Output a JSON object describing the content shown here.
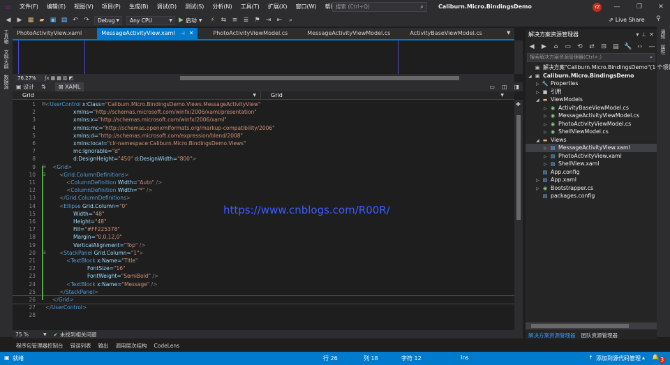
{
  "menubar": {
    "items": [
      "文件(F)",
      "编辑(E)",
      "视图(V)",
      "项目(P)",
      "生成(B)",
      "调试(D)",
      "测试(S)",
      "分析(N)",
      "工具(T)",
      "扩展(X)",
      "窗口(W)",
      "帮助(H)"
    ],
    "search_placeholder": "搜索 (Ctrl+Q)",
    "solution_title": "Caliburn.Micro.BindingsDemo",
    "avatar_initials": "YZ"
  },
  "toolbar": {
    "config": "Debug",
    "platform": "Any CPU",
    "start_label": "启动",
    "live_share": "Live Share"
  },
  "left_strip": [
    "工具箱",
    "文档大纲",
    "数据源"
  ],
  "right_strip": [
    "通知",
    "属性"
  ],
  "tabs": [
    {
      "label": "PhotoActivityView.xaml",
      "active": false
    },
    {
      "label": "MessageActivityView.xaml",
      "active": true
    },
    {
      "label": "PhotoActivityViewModel.cs",
      "active": false
    },
    {
      "label": "MessageActivityViewModel.cs",
      "active": false
    },
    {
      "label": "ActivityBaseViewModel.cs",
      "active": false
    }
  ],
  "designer": {
    "zoom": "76.27%"
  },
  "split": {
    "design": "设计",
    "xaml": "XAML"
  },
  "navbar": {
    "left": "Grid",
    "right": "Grid"
  },
  "code": [
    {
      "n": "1",
      "fold": "⊟",
      "indent": 0,
      "parts": [
        [
          "br",
          "<"
        ],
        [
          "tag",
          "UserControl"
        ],
        [
          "attr",
          " x:Class="
        ],
        [
          "val",
          "\"Caliburn.Micro.BindingsDemo.Views.MessageActivityView\""
        ]
      ]
    },
    {
      "n": "2",
      "fold": "",
      "indent": 8,
      "parts": [
        [
          "attr",
          "xmlns="
        ],
        [
          "val",
          "\"http://schemas.microsoft.com/winfx/2006/xaml/presentation\""
        ]
      ]
    },
    {
      "n": "3",
      "fold": "",
      "indent": 8,
      "parts": [
        [
          "attr",
          "xmlns:x="
        ],
        [
          "val",
          "\"http://schemas.microsoft.com/winfx/2006/xaml\""
        ]
      ]
    },
    {
      "n": "4",
      "fold": "",
      "indent": 8,
      "parts": [
        [
          "attr",
          "xmlns:mc="
        ],
        [
          "val",
          "\"http://schemas.openxmlformats.org/markup-compatibility/2006\""
        ]
      ]
    },
    {
      "n": "5",
      "fold": "",
      "indent": 8,
      "parts": [
        [
          "attr",
          "xmlns:d="
        ],
        [
          "val",
          "\"http://schemas.microsoft.com/expression/blend/2008\""
        ]
      ]
    },
    {
      "n": "6",
      "fold": "",
      "indent": 8,
      "parts": [
        [
          "attr",
          "xmlns:local="
        ],
        [
          "val",
          "\"clr-namespace:Caliburn.Micro.BindingsDemo.Views\""
        ]
      ]
    },
    {
      "n": "7",
      "fold": "",
      "indent": 8,
      "parts": [
        [
          "attr",
          "mc:Ignorable="
        ],
        [
          "val",
          "\"d\""
        ]
      ]
    },
    {
      "n": "8",
      "fold": "",
      "indent": 8,
      "parts": [
        [
          "attr",
          "d:DesignHeight="
        ],
        [
          "val",
          "\"450\""
        ],
        [
          "attr",
          " d:DesignWidth="
        ],
        [
          "val",
          "\"800\""
        ],
        [
          "br",
          ">"
        ]
      ]
    },
    {
      "n": "9",
      "fold": "⊟",
      "indent": 2,
      "parts": [
        [
          "br",
          "<"
        ],
        [
          "tag",
          "Grid"
        ],
        [
          "br",
          ">"
        ]
      ]
    },
    {
      "n": "10",
      "fold": "⊟",
      "indent": 4,
      "parts": [
        [
          "br",
          "<"
        ],
        [
          "tag",
          "Grid.ColumnDefinitions"
        ],
        [
          "br",
          ">"
        ]
      ]
    },
    {
      "n": "11",
      "fold": "",
      "indent": 6,
      "parts": [
        [
          "br",
          "<"
        ],
        [
          "tag",
          "ColumnDefinition"
        ],
        [
          "attr",
          " Width="
        ],
        [
          "val",
          "\"Auto\""
        ],
        [
          "br",
          " />"
        ]
      ]
    },
    {
      "n": "12",
      "fold": "",
      "indent": 6,
      "parts": [
        [
          "br",
          "<"
        ],
        [
          "tag",
          "ColumnDefinition"
        ],
        [
          "attr",
          " Width="
        ],
        [
          "val",
          "\"*\""
        ],
        [
          "br",
          " />"
        ]
      ]
    },
    {
      "n": "13",
      "fold": "",
      "indent": 4,
      "parts": [
        [
          "br",
          "</"
        ],
        [
          "tag",
          "Grid.ColumnDefinitions"
        ],
        [
          "br",
          ">"
        ]
      ]
    },
    {
      "n": "14",
      "fold": "",
      "indent": 4,
      "parts": [
        [
          "br",
          "<"
        ],
        [
          "tag",
          "Ellipse"
        ],
        [
          "attr",
          " Grid.Column="
        ],
        [
          "val",
          "\"0\""
        ]
      ]
    },
    {
      "n": "15",
      "fold": "",
      "indent": 8,
      "parts": [
        [
          "attr",
          "Width="
        ],
        [
          "val",
          "\"48\""
        ]
      ]
    },
    {
      "n": "16",
      "fold": "",
      "indent": 8,
      "parts": [
        [
          "attr",
          "Height="
        ],
        [
          "val",
          "\"48\""
        ]
      ]
    },
    {
      "n": "17",
      "fold": "",
      "indent": 8,
      "parts": [
        [
          "attr",
          "Fill="
        ],
        [
          "val",
          "\"#FF225378\""
        ]
      ]
    },
    {
      "n": "18",
      "fold": "",
      "indent": 8,
      "parts": [
        [
          "attr",
          "Margin="
        ],
        [
          "val",
          "\"0,0,12,0\""
        ]
      ]
    },
    {
      "n": "19",
      "fold": "",
      "indent": 8,
      "parts": [
        [
          "attr",
          "VerticalAlignment="
        ],
        [
          "val",
          "\"Top\""
        ],
        [
          "br",
          " />"
        ]
      ]
    },
    {
      "n": "20",
      "fold": "⊟",
      "indent": 4,
      "parts": [
        [
          "br",
          "<"
        ],
        [
          "tag",
          "StackPanel"
        ],
        [
          "attr",
          " Grid.Column="
        ],
        [
          "val",
          "\"1\""
        ],
        [
          "br",
          ">"
        ]
      ]
    },
    {
      "n": "21",
      "fold": "",
      "indent": 6,
      "parts": [
        [
          "br",
          "<"
        ],
        [
          "tag",
          "TextBlock"
        ],
        [
          "attr",
          " x:Name="
        ],
        [
          "val",
          "\"Title\""
        ]
      ]
    },
    {
      "n": "22",
      "fold": "",
      "indent": 12,
      "parts": [
        [
          "attr",
          "FontSize="
        ],
        [
          "val",
          "\"16\""
        ]
      ]
    },
    {
      "n": "23",
      "fold": "",
      "indent": 12,
      "parts": [
        [
          "attr",
          "FontWeight="
        ],
        [
          "val",
          "\"SemiBold\""
        ],
        [
          "br",
          " />"
        ]
      ]
    },
    {
      "n": "24",
      "fold": "",
      "indent": 6,
      "parts": [
        [
          "br",
          "<"
        ],
        [
          "tag",
          "TextBlock"
        ],
        [
          "attr",
          " x:Name="
        ],
        [
          "val",
          "\"Message\""
        ],
        [
          "br",
          " />"
        ]
      ]
    },
    {
      "n": "25",
      "fold": "",
      "indent": 4,
      "parts": [
        [
          "br",
          "</"
        ],
        [
          "tag",
          "StackPanel"
        ],
        [
          "br",
          ">"
        ]
      ]
    },
    {
      "n": "26",
      "fold": "",
      "indent": 2,
      "parts": [
        [
          "br",
          "</"
        ],
        [
          "tag",
          "Grid"
        ],
        [
          "br",
          ">"
        ]
      ],
      "current": true
    },
    {
      "n": "27",
      "fold": "",
      "indent": 0,
      "parts": [
        [
          "br",
          "</"
        ],
        [
          "tag",
          "UserControl"
        ],
        [
          "br",
          ">"
        ]
      ]
    },
    {
      "n": "28",
      "fold": "",
      "indent": 0,
      "parts": []
    }
  ],
  "watermark": "https://www.cnblogs.com/R00R/",
  "editor_status": {
    "zoom": "75 %",
    "issues": "未找到相关问题"
  },
  "bottom_tabs": [
    "程序包管理器控制台",
    "错误列表",
    "输出",
    "调用层次结构",
    "CodeLens"
  ],
  "solution": {
    "header": "解决方案资源管理器",
    "search_placeholder": "搜索解决方案资源管理器(Ctrl+;)",
    "tree": [
      {
        "label": "解决方案\"Caliburn.Micro.BindingsDemo\"(1 个项目",
        "depth": 0,
        "arrow": "",
        "icon": "▣",
        "bold": false
      },
      {
        "label": "Caliburn.Micro.BindingsDemo",
        "depth": 0,
        "arrow": "◢",
        "icon": "▣",
        "bold": true
      },
      {
        "label": "Properties",
        "depth": 1,
        "arrow": "▷",
        "icon": "🔧",
        "bold": false
      },
      {
        "label": "引用",
        "depth": 1,
        "arrow": "▷",
        "icon": "■",
        "bold": false
      },
      {
        "label": "ViewModels",
        "depth": 1,
        "arrow": "◢",
        "icon": "▬",
        "bold": false
      },
      {
        "label": "ActivityBaseViewModel.cs",
        "depth": 2,
        "arrow": "▷",
        "icon": "◉",
        "bold": false
      },
      {
        "label": "MessageActivityViewModel.cs",
        "depth": 2,
        "arrow": "▷",
        "icon": "◉",
        "bold": false
      },
      {
        "label": "PhotoActivityViewModel.cs",
        "depth": 2,
        "arrow": "▷",
        "icon": "◉",
        "bold": false
      },
      {
        "label": "ShellViewModel.cs",
        "depth": 2,
        "arrow": "▷",
        "icon": "◉",
        "bold": false
      },
      {
        "label": "Views",
        "depth": 1,
        "arrow": "◢",
        "icon": "▬",
        "bold": false
      },
      {
        "label": "MessageActivityView.xaml",
        "depth": 2,
        "arrow": "▷",
        "icon": "▤",
        "bold": false,
        "selected": true
      },
      {
        "label": "PhotoActivityView.xaml",
        "depth": 2,
        "arrow": "▷",
        "icon": "▤",
        "bold": false
      },
      {
        "label": "ShellView.xaml",
        "depth": 2,
        "arrow": "▷",
        "icon": "▤",
        "bold": false
      },
      {
        "label": "App.config",
        "depth": 1,
        "arrow": "",
        "icon": "▤",
        "bold": false
      },
      {
        "label": "App.xaml",
        "depth": 1,
        "arrow": "▷",
        "icon": "▤",
        "bold": false
      },
      {
        "label": "Bootstrapper.cs",
        "depth": 1,
        "arrow": "▷",
        "icon": "◉",
        "bold": false
      },
      {
        "label": "packages.config",
        "depth": 1,
        "arrow": "",
        "icon": "▤",
        "bold": false
      }
    ],
    "tabs": [
      "解决方案资源管理器",
      "团队资源管理器"
    ]
  },
  "statusbar": {
    "ready": "就绪",
    "line": "行 26",
    "col": "列 18",
    "char": "字符 12",
    "mode": "Ins",
    "source_control": "添加到源代码管理",
    "error_count": "3"
  },
  "colors": {
    "accent": "#007acc",
    "background": "#1e1e1e",
    "chrome": "#2d2d30",
    "tag": "#569cd6",
    "attr": "#9cdcfe",
    "value": "#ce9178",
    "watermark": "#3c5cff"
  }
}
